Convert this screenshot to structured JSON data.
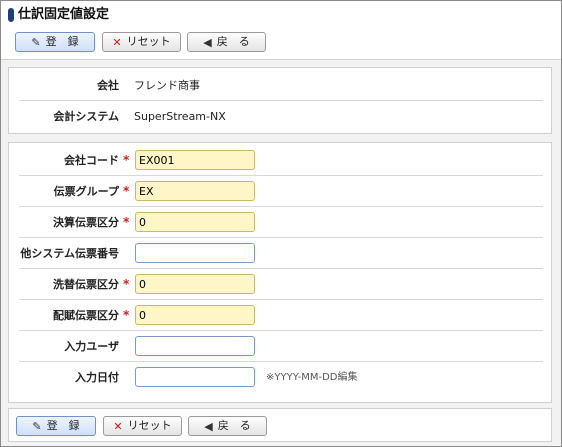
{
  "window": {
    "title": "仕訳固定値設定"
  },
  "toolbar": {
    "register_label": "登　録",
    "reset_label": "リセット",
    "back_label": "戻　る"
  },
  "info": {
    "company_label": "会社",
    "company_value": "フレンド商事",
    "system_label": "会計システム",
    "system_value": "SuperStream-NX"
  },
  "form": {
    "company_code": {
      "label": "会社コード",
      "value": "EX001",
      "required": "*"
    },
    "slip_group": {
      "label": "伝票グループ",
      "value": "EX",
      "required": "*"
    },
    "settlement_category": {
      "label": "決算伝票区分",
      "value": "0",
      "required": "*"
    },
    "other_system_slip_no": {
      "label": "他システム伝票番号",
      "value": ""
    },
    "wash_category": {
      "label": "洗替伝票区分",
      "value": "0",
      "required": "*"
    },
    "allocation_category": {
      "label": "配賦伝票区分",
      "value": "0",
      "required": "*"
    },
    "input_user": {
      "label": "入力ユーザ",
      "value": ""
    },
    "input_date": {
      "label": "入力日付",
      "value": "",
      "hint": "※YYYY-MM-DD編集"
    }
  },
  "icons": {
    "register": "pencil-icon",
    "reset": "x-icon",
    "back": "arrow-left-icon"
  },
  "colors": {
    "required_mark": "#d31c1c",
    "required_field_bg": "#fff6c8",
    "primary_button_bg": "#cfe0fb",
    "title_mark": "#1f3f73"
  }
}
